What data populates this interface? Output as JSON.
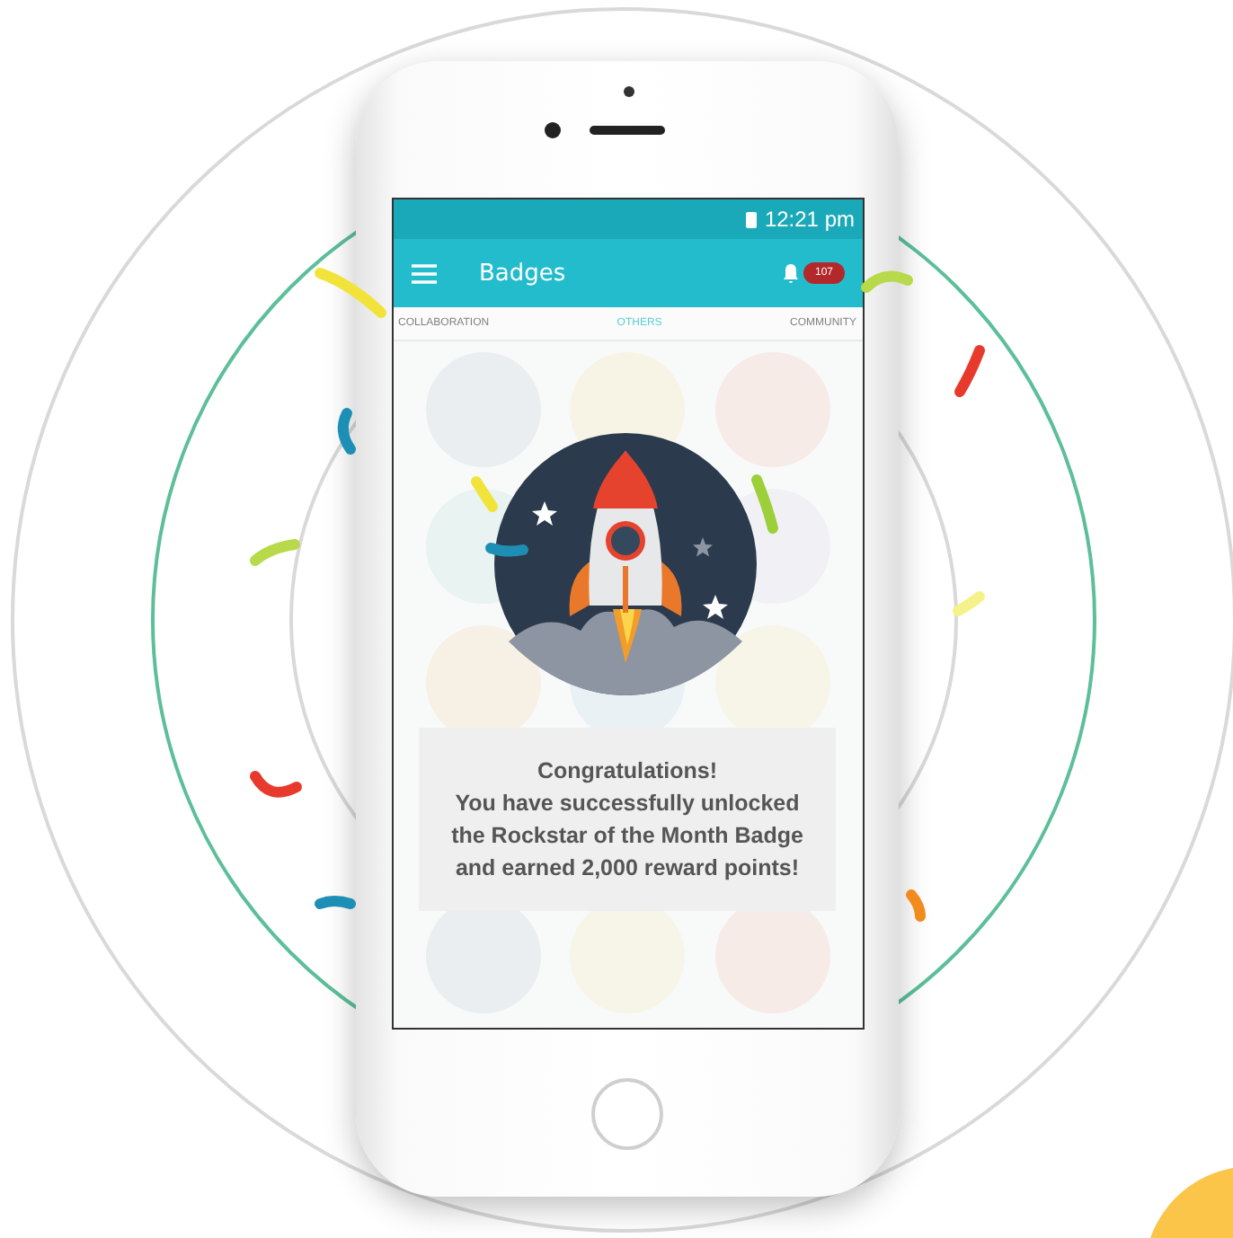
{
  "status_bar": {
    "time": "12:21 pm"
  },
  "app_bar": {
    "title": "Badges",
    "notification_count": "107"
  },
  "tabs": [
    {
      "label": "COLLABORATION",
      "selected": false
    },
    {
      "label": "OTHERS",
      "selected": true
    },
    {
      "label": "COMMUNITY",
      "selected": false
    }
  ],
  "dialog": {
    "message": "Congratulations!\nYou have successfully unlocked\nthe Rockstar of the Month Badge\nand earned 2,000 reward points!"
  }
}
